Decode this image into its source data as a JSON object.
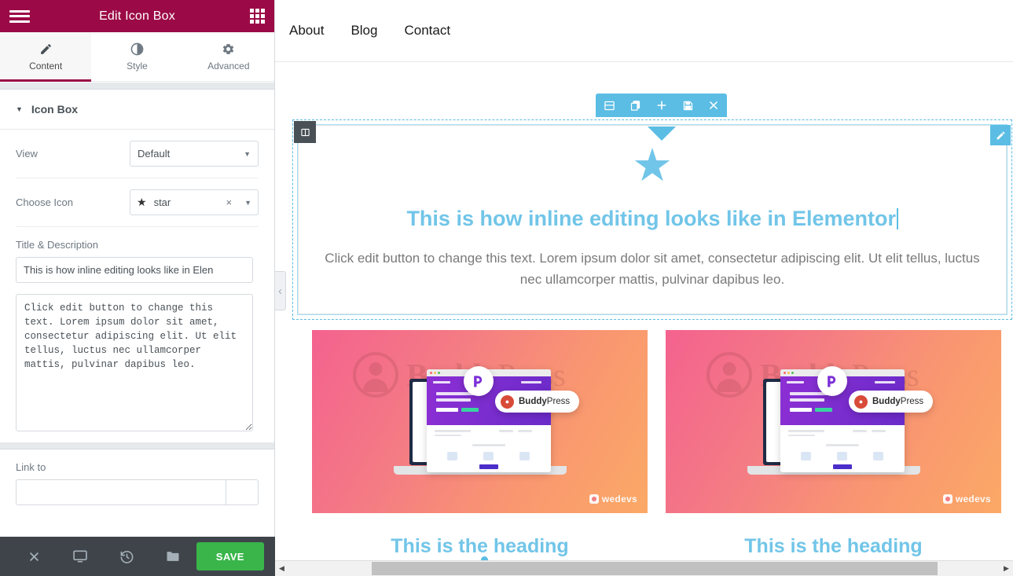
{
  "panel": {
    "header": {
      "title": "Edit Icon Box",
      "menu_icon": "hamburger-icon",
      "widgets_icon": "grid-icon"
    },
    "tabs": [
      {
        "label": "Content",
        "icon": "pencil-icon",
        "active": true
      },
      {
        "label": "Style",
        "icon": "contrast-icon",
        "active": false
      },
      {
        "label": "Advanced",
        "icon": "gear-icon",
        "active": false
      }
    ],
    "accordion": {
      "title": "Icon Box",
      "caret": "▼"
    },
    "controls": {
      "view_label": "View",
      "view_value": "Default",
      "choose_icon_label": "Choose Icon",
      "choose_icon_value": "star",
      "choose_icon_glyph": "★",
      "clear_icon": "×",
      "title_description_label": "Title & Description",
      "title_value": "This is how inline editing looks like in Elen",
      "description_value": "Click edit button to change this text. Lorem ipsum dolor sit amet, consectetur adipiscing elit. Ut elit tellus, luctus nec ullamcorper mattis, pulvinar dapibus leo.",
      "link_to_label": "Link to",
      "link_to_value": ""
    },
    "footer": {
      "close_icon": "close-icon",
      "responsive_icon": "monitor-icon",
      "history_icon": "history-icon",
      "folder_icon": "folder-icon",
      "save_label": "SAVE"
    },
    "collapse_arrow": "‹"
  },
  "canvas": {
    "site_nav": [
      {
        "label": "About"
      },
      {
        "label": "Blog"
      },
      {
        "label": "Contact"
      }
    ],
    "section_toolbar": [
      {
        "icon": "columns-icon",
        "name": "edit-section"
      },
      {
        "icon": "duplicate-icon",
        "name": "duplicate-section"
      },
      {
        "icon": "plus-icon",
        "name": "add-section"
      },
      {
        "icon": "floppy-icon",
        "name": "save-section"
      },
      {
        "icon": "close-icon",
        "name": "remove-section"
      }
    ],
    "column_handle_icon": "columns-icon",
    "edit_pencil_icon": "pencil-icon",
    "widget": {
      "icon": "star-icon",
      "icon_glyph": "★",
      "title": "This is how inline editing looks like in Elementor",
      "description": "Click edit button to change this text. Lorem ipsum dolor sit amet, consectetur adipiscing elit. Ut elit tellus, luctus nec ullamcorper mattis, pulvinar dapibus leo."
    },
    "cards": [
      {
        "watermark": "BuddyPress",
        "watermark_bold": "Buddy",
        "watermark_rest": "Press",
        "badge_text": "BuddyPress",
        "badge_bold": "Buddy",
        "badge_rest": "Press",
        "logo": "wedevs",
        "heading": "This is the heading"
      },
      {
        "watermark": "BuddyPress",
        "watermark_bold": "Buddy",
        "watermark_rest": "Press",
        "badge_text": "BuddyPress",
        "badge_bold": "Buddy",
        "badge_rest": "Press",
        "logo": "wedevs",
        "heading": "This is the heading"
      }
    ],
    "scrollbar": {
      "left_arrow": "◀",
      "right_arrow": "▶"
    }
  },
  "colors": {
    "panel_header": "#9b0a46",
    "accent_blue": "#71c5e8",
    "toolbar_blue": "#5bbde4",
    "save_green": "#39b54a",
    "footer_dark": "#3f444b"
  }
}
